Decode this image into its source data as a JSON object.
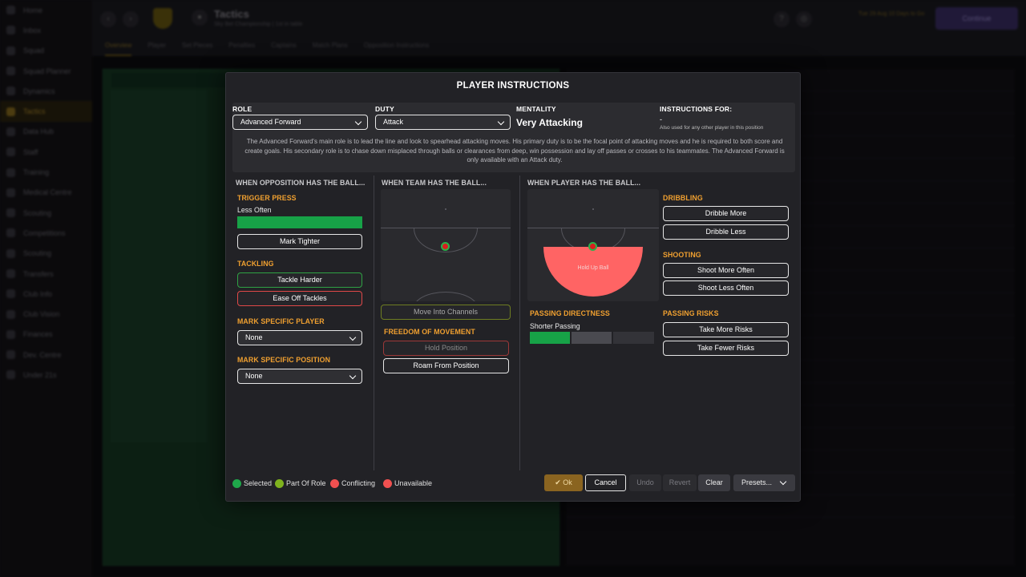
{
  "background": {
    "sidebar_items": [
      "Home",
      "Inbox",
      "Squad",
      "Squad Planner",
      "Dynamics",
      "Tactics",
      "Data Hub",
      "Staff",
      "Training",
      "Medical Centre",
      "Scouting",
      "Competitions",
      "Scouting",
      "Transfers",
      "Club Info",
      "Club Vision",
      "Finances",
      "Dev. Centre",
      "Under 21s"
    ],
    "title": "Tactics",
    "subtitle": "Sky Bet Championship | 1st in table",
    "tabs": [
      "Overview",
      "Player",
      "Set Pieces",
      "Penalties",
      "Captains",
      "Match Plans",
      "Opposition Instructions"
    ],
    "continue_label": "Continue",
    "next_fixture": "Tue 29 Aug\n10 Days to Go"
  },
  "modal": {
    "title": "PLAYER INSTRUCTIONS",
    "role_label": "ROLE",
    "role_value": "Advanced Forward",
    "duty_label": "DUTY",
    "duty_value": "Attack",
    "mentality_label": "MENTALITY",
    "mentality_value": "Very Attacking",
    "instructions_for_label": "INSTRUCTIONS FOR:",
    "instructions_for_value": "-",
    "instructions_for_note": "Also used for any other player in this position",
    "role_description": "The Advanced Forward's main role is to lead the line and look to spearhead attacking moves. His primary duty is to be the focal point of attacking moves and he is required to both score and create goals. His secondary role is to chase down misplaced through balls or clearances from deep, win possession and lay off passes or crosses to his teammates. The Advanced Forward is only available with an Attack duty."
  },
  "opposition": {
    "header": "WHEN OPPOSITION HAS THE BALL...",
    "trigger_press_label": "TRIGGER PRESS",
    "trigger_press_value": "Less Often",
    "trigger_press_level": 1.0,
    "mark_tighter": "Mark Tighter",
    "tackling_label": "TACKLING",
    "tackle_harder": "Tackle Harder",
    "ease_off_tackles": "Ease Off Tackles",
    "mark_player_label": "MARK SPECIFIC PLAYER",
    "mark_player_value": "None",
    "mark_position_label": "MARK SPECIFIC POSITION",
    "mark_position_value": "None"
  },
  "team": {
    "header": "WHEN TEAM HAS THE BALL...",
    "move_into_channels": "Move Into Channels",
    "freedom_label": "FREEDOM OF MOVEMENT",
    "hold_position": "Hold Position",
    "roam_from_position": "Roam From Position"
  },
  "player": {
    "header": "WHEN PLAYER HAS THE BALL...",
    "hold_up_ball": "Hold Up Ball",
    "passing_directness_label": "PASSING DIRECTNESS",
    "passing_directness_value": "Shorter Passing",
    "dribbling_label": "DRIBBLING",
    "dribble_more": "Dribble More",
    "dribble_less": "Dribble Less",
    "shooting_label": "SHOOTING",
    "shoot_more": "Shoot More Often",
    "shoot_less": "Shoot Less Often",
    "passing_risks_label": "PASSING RISKS",
    "more_risks": "Take More Risks",
    "fewer_risks": "Take Fewer Risks"
  },
  "legend": [
    {
      "label": "Selected",
      "color": "#1fa84a"
    },
    {
      "label": "Part Of Role",
      "color": "#7fb21e"
    },
    {
      "label": "Conflicting",
      "color": "#f05050"
    },
    {
      "label": "Unavailable",
      "color": "#f05050"
    }
  ],
  "footer": {
    "ok": "Ok",
    "cancel": "Cancel",
    "undo": "Undo",
    "revert": "Revert",
    "clear": "Clear",
    "presets": "Presets..."
  },
  "colors": {
    "accent_orange": "#f0a030",
    "selected_green": "#17a247",
    "ok_gold": "#8a6420"
  }
}
